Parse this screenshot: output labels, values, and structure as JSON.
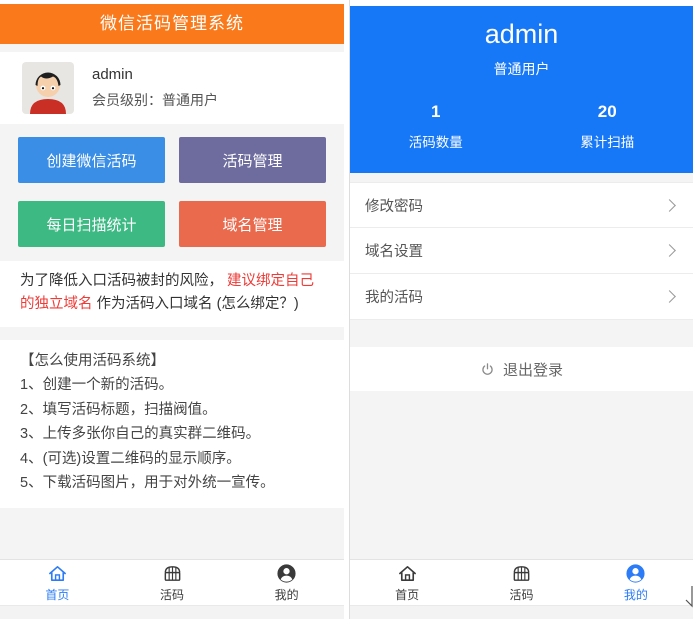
{
  "colors": {
    "left_header_bg": "#fa7a1b",
    "right_header_bg": "#1778f7",
    "btn_create": "#3a8ee6",
    "btn_manage": "#6e6c9e",
    "btn_stats": "#3db983",
    "btn_domain": "#e96a4d",
    "highlight_red": "#ee3b37",
    "active_tab": "#2b7cf6"
  },
  "left": {
    "header_title": "微信活码管理系统",
    "profile": {
      "name": "admin",
      "level_label": "会员级别：普通用户"
    },
    "buttons": [
      {
        "label": "创建微信活码"
      },
      {
        "label": "活码管理"
      },
      {
        "label": "每日扫描统计"
      },
      {
        "label": "域名管理"
      }
    ],
    "notice": {
      "pre": "为了降低入口活码被封的风险，",
      "highlight": "建议绑定自己的独立域名",
      "post": "作为活码入口域名",
      "link": "(怎么绑定？)"
    },
    "guide": {
      "title": "【怎么使用活码系统】",
      "steps": [
        "1、创建一个新的活码。",
        "2、填写活码标题，扫描阀值。",
        "3、上传多张你自己的真实群二维码。",
        "4、(可选)设置二维码的显示顺序。",
        "5、下载活码图片，用于对外统一宣传。"
      ]
    },
    "tabbar": [
      {
        "label": "首页",
        "icon": "home-icon",
        "active": true
      },
      {
        "label": "活码",
        "icon": "qr-chest-icon",
        "active": false
      },
      {
        "label": "我的",
        "icon": "user-icon",
        "active": false
      }
    ]
  },
  "right": {
    "profile": {
      "name": "admin",
      "role": "普通用户"
    },
    "stats": [
      {
        "value": "1",
        "label": "活码数量"
      },
      {
        "value": "20",
        "label": "累计扫描"
      }
    ],
    "menu": [
      {
        "label": "修改密码"
      },
      {
        "label": "域名设置"
      },
      {
        "label": "我的活码"
      }
    ],
    "logout_label": "退出登录",
    "tabbar": [
      {
        "label": "首页",
        "icon": "home-icon",
        "active": false
      },
      {
        "label": "活码",
        "icon": "qr-chest-icon",
        "active": false
      },
      {
        "label": "我的",
        "icon": "user-icon",
        "active": true
      }
    ]
  }
}
